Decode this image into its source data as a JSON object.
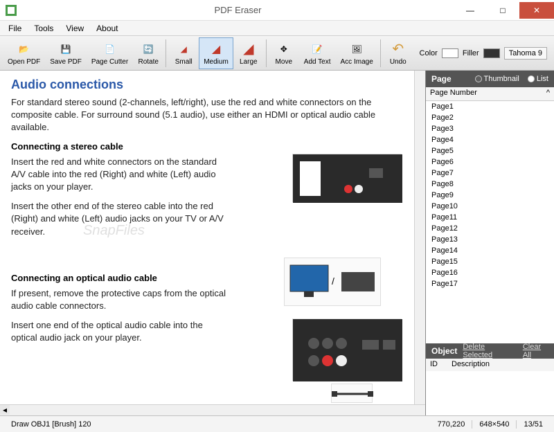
{
  "window": {
    "title": "PDF Eraser",
    "minimize": "—",
    "maximize": "□",
    "close": "✕"
  },
  "menu": {
    "items": [
      "File",
      "Tools",
      "View",
      "About"
    ]
  },
  "toolbar": {
    "buttons": [
      {
        "label": "Open PDF",
        "icon": "📂"
      },
      {
        "label": "Save PDF",
        "icon": "💾"
      },
      {
        "label": "Page Cutter",
        "icon": "📄"
      },
      {
        "label": "Rotate",
        "icon": "🔄"
      }
    ],
    "erasers": [
      {
        "label": "Small",
        "icon": "◢"
      },
      {
        "label": "Medium",
        "icon": "◢"
      },
      {
        "label": "Large",
        "icon": "◢"
      }
    ],
    "tools2": [
      {
        "label": "Move",
        "icon": "✥"
      },
      {
        "label": "Add Text",
        "icon": "📝"
      },
      {
        "label": "Acc Image",
        "icon": "🖼"
      }
    ],
    "undo": {
      "label": "Undo",
      "icon": "↶"
    },
    "props": {
      "color_label": "Color",
      "filler_label": "Filler",
      "font_label": "Tahoma 9"
    },
    "selected": "Medium"
  },
  "document": {
    "heading": "Audio connections",
    "para1": "For standard stereo sound (2-channels, left/right), use the red and white connectors on the composite cable. For surround sound (5.1 audio), use either an HDMI or optical audio cable available.",
    "sub1": "Connecting a stereo cable",
    "para2": "Insert the red and white connectors on the standard A/V cable into the red (Right) and white (Left) audio jacks on your player.",
    "para3": "Insert the other end of the stereo cable into the red (Right) and white (Left) audio jacks on your TV or A/V receiver.",
    "sub2": "Connecting an optical audio cable",
    "para4": "If present, remove the protective caps from the optical audio cable connectors.",
    "para5": "Insert one end of the optical audio cable into the optical audio jack on your player.",
    "watermark": "SnapFiles"
  },
  "sidebar": {
    "page_label": "Page",
    "thumbnail_label": "Thumbnail",
    "list_label": "List",
    "view_mode": "List",
    "col_header": "Page Number",
    "pages": [
      "Page1",
      "Page2",
      "Page3",
      "Page4",
      "Page5",
      "Page6",
      "Page7",
      "Page8",
      "Page9",
      "Page10",
      "Page11",
      "Page12",
      "Page13",
      "Page14",
      "Page15",
      "Page16",
      "Page17"
    ],
    "object_label": "Object",
    "delete_selected": "Delete Selected",
    "clear_all": "Clear All",
    "obj_col1": "ID",
    "obj_col2": "Description"
  },
  "status": {
    "draw_info": "Draw OBJ1 [Brush] 120",
    "coords": "770,220",
    "dims": "648×540",
    "page_nav": "13/51"
  }
}
